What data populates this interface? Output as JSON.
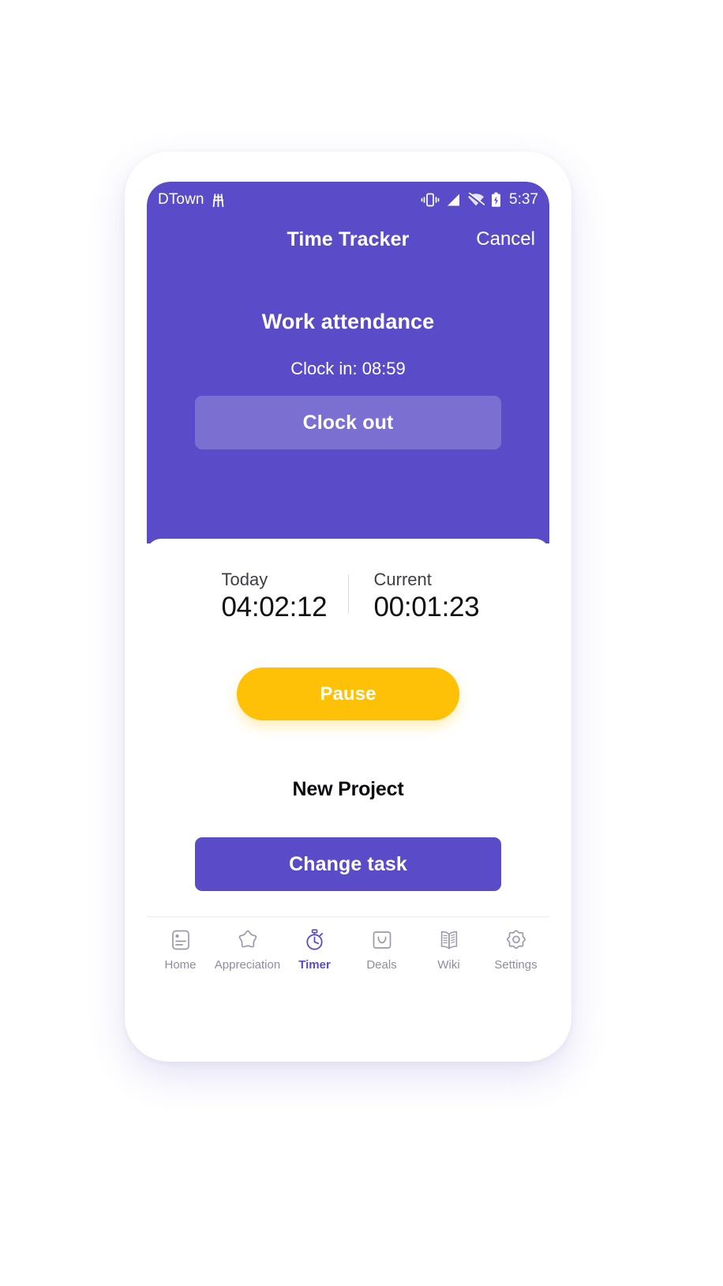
{
  "status_bar": {
    "carrier": "DTown",
    "carrier_icon": "network-tower-icon",
    "vibrate_icon": "vibrate-icon",
    "cellular_icon": "cellular-signal-icon",
    "wifi_icon": "wifi-off-icon",
    "battery_icon": "battery-charging-icon",
    "time": "5:37"
  },
  "app_bar": {
    "title": "Time Tracker",
    "cancel_label": "Cancel"
  },
  "attendance": {
    "title": "Work attendance",
    "clock_in_line": "Clock in: 08:59",
    "clock_out_label": "Clock out"
  },
  "timers": [
    {
      "label": "Today",
      "value": "04:02:12"
    },
    {
      "label": "Current",
      "value": "00:01:23"
    }
  ],
  "actions": {
    "pause_label": "Pause",
    "project_name": "New Project",
    "change_task_label": "Change task"
  },
  "bottom_nav": {
    "items": [
      {
        "label": "Home",
        "icon": "id-card-icon",
        "active": false
      },
      {
        "label": "Appreciation",
        "icon": "star-icon",
        "active": false
      },
      {
        "label": "Timer",
        "icon": "stopwatch-icon",
        "active": true
      },
      {
        "label": "Deals",
        "icon": "shopping-bag-icon",
        "active": false
      },
      {
        "label": "Wiki",
        "icon": "open-book-icon",
        "active": false
      },
      {
        "label": "Settings",
        "icon": "gear-icon",
        "active": false
      }
    ]
  },
  "colors": {
    "brand_purple": "#5a4bc9",
    "light_purple": "#7b6fd1",
    "amber": "#ffc107",
    "nav_inactive": "#9b99ab"
  }
}
